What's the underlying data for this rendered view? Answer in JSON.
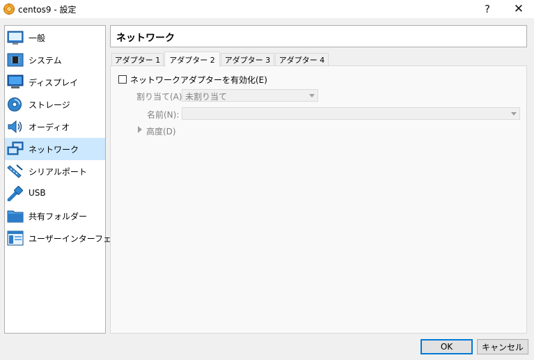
{
  "window": {
    "title": "centos9 - 設定",
    "help_button": "?",
    "close_button": "✕"
  },
  "sidebar": {
    "items": [
      {
        "label": "一般",
        "icon": "general-icon",
        "selected": false
      },
      {
        "label": "システム",
        "icon": "system-icon",
        "selected": false
      },
      {
        "label": "ディスプレイ",
        "icon": "display-icon",
        "selected": false
      },
      {
        "label": "ストレージ",
        "icon": "storage-icon",
        "selected": false
      },
      {
        "label": "オーディオ",
        "icon": "audio-icon",
        "selected": false
      },
      {
        "label": "ネットワーク",
        "icon": "network-icon",
        "selected": true
      },
      {
        "label": "シリアルポート",
        "icon": "serial-port-icon",
        "selected": false
      },
      {
        "label": "USB",
        "icon": "usb-icon",
        "selected": false
      },
      {
        "label": "共有フォルダー",
        "icon": "shared-folder-icon",
        "selected": false
      },
      {
        "label": "ユーザーインターフェース",
        "icon": "user-interface-icon",
        "selected": false
      }
    ]
  },
  "header": {
    "title": "ネットワーク"
  },
  "tabs": [
    {
      "label": "アダプター 1",
      "active": false
    },
    {
      "label": "アダプター 2",
      "active": true
    },
    {
      "label": "アダプター 3",
      "active": false
    },
    {
      "label": "アダプター 4",
      "active": false
    }
  ],
  "adapter": {
    "enable_label": "ネットワークアダプターを有効化(E)",
    "enabled": false,
    "attached_label": "割り当て(A):",
    "attached_value": "未割り当て",
    "name_label": "名前(N):",
    "name_value": "",
    "advanced_label": "高度(D)"
  },
  "footer": {
    "ok_label": "OK",
    "cancel_label": "キャンセル"
  },
  "colors": {
    "selection": "#cce8ff",
    "accent": "#0078d7",
    "disabled_text": "#808080"
  }
}
